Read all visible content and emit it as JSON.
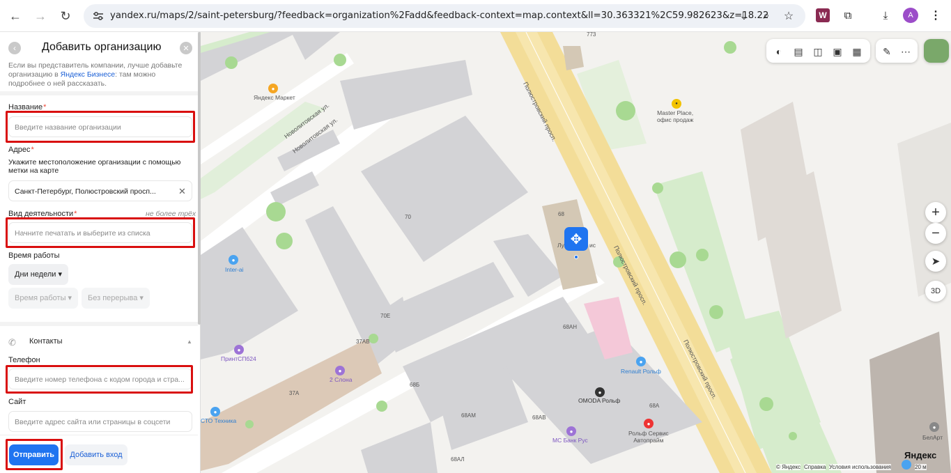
{
  "browser": {
    "url": "yandex.ru/maps/2/saint-petersburg/?feedback=organization%2Fadd&feedback-context=map.context&ll=30.363321%2C59.982623&z=18.22",
    "profile_initial": "A"
  },
  "form": {
    "title": "Добавить организацию",
    "desc_before": "Если вы представитель компании, лучше добавьте организацию в ",
    "desc_link": "Яндекс Бизнесе",
    "desc_after": ": там можно подробнее о ней рассказать.",
    "name_label": "Название",
    "name_placeholder": "Введите название организации",
    "address_label": "Адрес",
    "address_hint": "Укажите местоположение организации с помощью метки на карте",
    "address_value": "Санкт-Петербург, Полюстровский просп...",
    "activity_label": "Вид деятельности",
    "activity_limit": "не более трёх",
    "activity_placeholder": "Начните печатать и выберите из списка",
    "hours_label": "Время работы",
    "days_select": "Дни недели ▾",
    "hours_select": "Время работы ▾",
    "break_select": "Без перерыва ▾",
    "contacts_label": "Контакты",
    "phone_label": "Телефон",
    "phone_placeholder": "Введите номер телефона с кодом города и стра...",
    "site_label": "Сайт",
    "site_placeholder": "Введите адрес сайта или страницы в соцсети",
    "submit": "Отправить",
    "add_entry": "Добавить вход",
    "required_mark": "*"
  },
  "map": {
    "street_labels": [
      "Полюстровский просп.",
      "Полюстровский просп.",
      "Полюстровский просп.",
      "Новолитовская ул.",
      "Новолитовская ул."
    ],
    "building_numbers": [
      "773",
      "70",
      "68",
      "70Е",
      "37АВ",
      "68АН",
      "68Б",
      "37А",
      "68АМ",
      "68АВ",
      "68А",
      "68АЛ"
    ],
    "pois": {
      "yandex_market": "Яндекс Маркет",
      "master_place": "Master Place,\nофис продаж",
      "inter_ai": "Inter-ai",
      "printspb": "ПринтСПб24",
      "two_elephants": "2 Слона",
      "renault": "Renault Рольф",
      "omoda": "OMODA Рольф",
      "ms_bank": "МС Банк Рус",
      "rolf_service": "Рольф Сервис\nАвтопрайм",
      "sto": "СТО Техника",
      "lu_partial": "Лу",
      "is_partial": "ис",
      "belart": "БелАрт"
    },
    "btn_3d": "3D",
    "zoom_in": "+",
    "zoom_out": "−",
    "logo": "Яндекс",
    "footer": {
      "copyright": "© Яндекс",
      "help": "Справка",
      "terms": "Условия использования",
      "scale": "20 м"
    }
  },
  "icons": [
    "back-icon",
    "forward-icon",
    "reload-icon",
    "tune-icon",
    "install-icon",
    "zoom-icon",
    "bookmark-star-icon",
    "extension-w-icon",
    "puzzle-icon",
    "download-icon",
    "menu-dots-icon",
    "phone-icon",
    "move-icon",
    "locate-icon",
    "ruler-icon",
    "layers-icon"
  ],
  "colors": {
    "accent": "#1f74f0",
    "highlight": "#d90f0f",
    "road": "#f6e3a6"
  }
}
